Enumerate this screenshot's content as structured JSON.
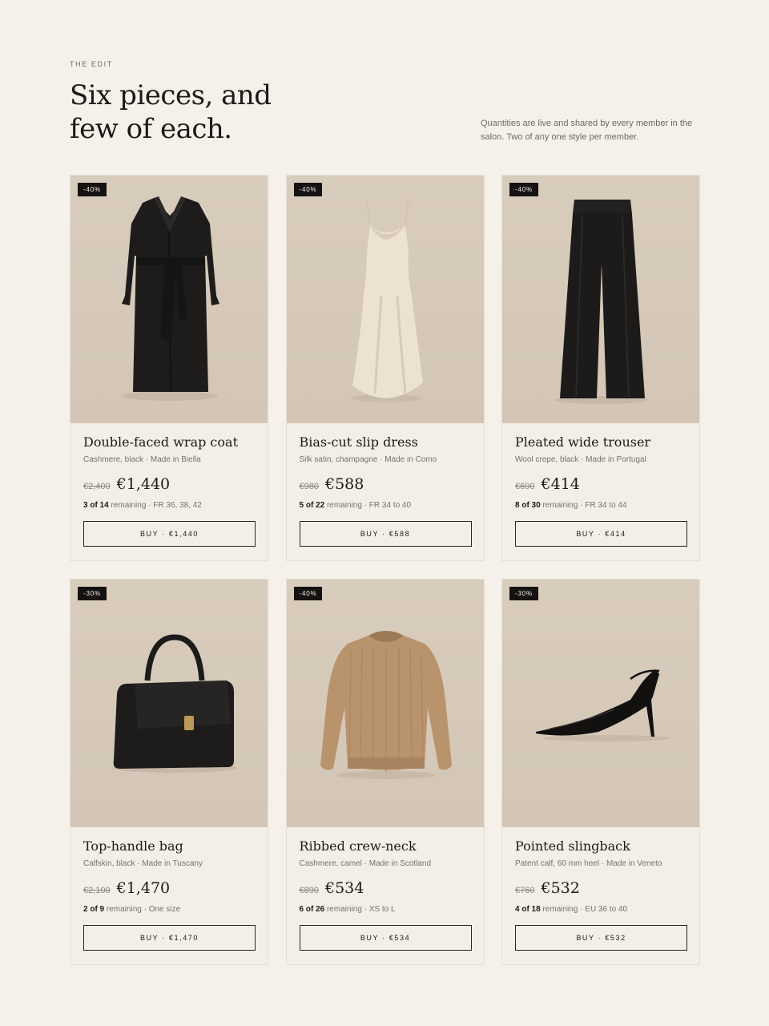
{
  "header": {
    "eyebrow": "THE EDIT",
    "title": "Six pieces, and few of each.",
    "intro": "Quantities are live and shared by every member in the salon. Two of any one style per member."
  },
  "colors": {
    "background": "#f5f1ea",
    "photo_bg": "#d6cabb",
    "ink": "#1c1a17",
    "badge": "#151311"
  },
  "products": [
    {
      "badge": "-40%",
      "image": "black-wrap-coat-image",
      "name": "Double-faced wrap coat",
      "meta": "Cashmere, black · Made in Biella",
      "was": "€2,400",
      "now": "€1,440",
      "remaining_count": "3 of 14",
      "remaining_word": " remaining",
      "sizes": " · FR 36, 38, 42",
      "buy": "BUY · €1,440"
    },
    {
      "badge": "-40%",
      "image": "champagne-slip-dress-image",
      "name": "Bias-cut slip dress",
      "meta": "Silk satin, champagne · Made in Como",
      "was": "€980",
      "now": "€588",
      "remaining_count": "5 of 22",
      "remaining_word": " remaining",
      "sizes": " · FR 34 to 40",
      "buy": "BUY · €588"
    },
    {
      "badge": "-40%",
      "image": "black-wide-trouser-image",
      "name": "Pleated wide trouser",
      "meta": "Wool crepe, black · Made in Portugal",
      "was": "€690",
      "now": "€414",
      "remaining_count": "8 of 30",
      "remaining_word": " remaining",
      "sizes": " · FR 34 to 44",
      "buy": "BUY · €414"
    },
    {
      "badge": "-30%",
      "image": "black-top-handle-bag-image",
      "name": "Top-handle bag",
      "meta": "Calfskin, black · Made in Tuscany",
      "was": "€2,100",
      "now": "€1,470",
      "remaining_count": "2 of 9",
      "remaining_word": " remaining",
      "sizes": " · One size",
      "buy": "BUY · €1,470"
    },
    {
      "badge": "-40%",
      "image": "camel-crew-neck-image",
      "name": "Ribbed crew-neck",
      "meta": "Cashmere, camel · Made in Scotland",
      "was": "€890",
      "now": "€534",
      "remaining_count": "6 of 26",
      "remaining_word": " remaining",
      "sizes": " · XS to L",
      "buy": "BUY · €534"
    },
    {
      "badge": "-30%",
      "image": "black-slingback-shoe-image",
      "name": "Pointed slingback",
      "meta": "Patent calf, 60 mm heel · Made in Veneto",
      "was": "€760",
      "now": "€532",
      "remaining_count": "4 of 18",
      "remaining_word": " remaining",
      "sizes": " · EU 36 to 40",
      "buy": "BUY · €532"
    }
  ]
}
